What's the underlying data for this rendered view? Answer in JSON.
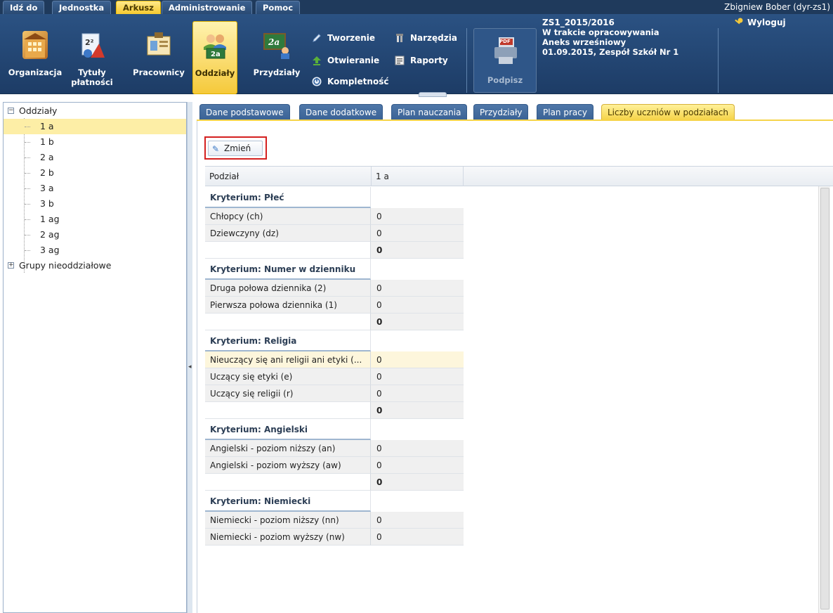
{
  "menu": {
    "items": [
      "Idź do",
      "Jednostka",
      "Arkusz",
      "Administrowanie",
      "Pomoc"
    ],
    "active": "Arkusz",
    "user": "Zbigniew Bober (dyr-zs1)"
  },
  "ribbon": {
    "buttons": [
      "Organizacja",
      "Tytuły płatności",
      "Pracownicy",
      "Oddziały",
      "Przydziały"
    ],
    "tytuly_line1": "Tytuły",
    "tytuly_line2": "płatności",
    "active": "Oddziały",
    "small": {
      "tworzenie": "Tworzenie",
      "otwieranie": "Otwieranie",
      "kompletnosc": "Kompletność",
      "narzedzia": "Narzędzia",
      "raporty": "Raporty"
    },
    "podpisz": "Podpisz",
    "pdf_badge": "PDF",
    "doc": {
      "line1": "ZS1_2015/2016",
      "line2": "W trakcie opracowywania",
      "line3": "Aneks wrześniowy",
      "line4": "01.09.2015, Zespół Szkół Nr 1"
    },
    "wyloguj": "Wyloguj",
    "icon_2a": "2a"
  },
  "tree": {
    "root": "Oddziały",
    "items": [
      "1 a",
      "1 b",
      "2 a",
      "2 b",
      "3 a",
      "3 b",
      "1 ag",
      "2 ag",
      "3 ag"
    ],
    "selected": "1 a",
    "other": "Grupy nieoddziałowe"
  },
  "tabs": [
    "Dane podstawowe",
    "Dane dodatkowe",
    "Plan nauczania",
    "Przydziały",
    "Plan pracy",
    "Liczby uczniów w podziałach"
  ],
  "active_tab": "Liczby uczniów w podziałach",
  "toolbar": {
    "zmien": "Zmień"
  },
  "grid": {
    "headers": [
      "Podział",
      "1 a"
    ],
    "rows": [
      {
        "type": "crit",
        "label": "Kryterium: Płeć",
        "value": ""
      },
      {
        "type": "item",
        "label": "Chłopcy (ch)",
        "value": "0"
      },
      {
        "type": "item",
        "label": "Dziewczyny (dz)",
        "value": "0"
      },
      {
        "type": "sum",
        "label": "",
        "value": "0"
      },
      {
        "type": "crit",
        "label": "Kryterium: Numer w dzienniku",
        "value": ""
      },
      {
        "type": "item",
        "label": "Druga połowa dziennika (2)",
        "value": "0"
      },
      {
        "type": "item",
        "label": "Pierwsza połowa dziennika (1)",
        "value": "0"
      },
      {
        "type": "sum",
        "label": "",
        "value": "0"
      },
      {
        "type": "crit",
        "label": "Kryterium: Religia",
        "value": ""
      },
      {
        "type": "hl",
        "label": "Nieuczący się ani religii ani etyki (...",
        "value": "0"
      },
      {
        "type": "item",
        "label": "Uczący się etyki (e)",
        "value": "0"
      },
      {
        "type": "item",
        "label": "Uczący się religii (r)",
        "value": "0"
      },
      {
        "type": "sum",
        "label": "",
        "value": "0"
      },
      {
        "type": "crit",
        "label": "Kryterium: Angielski",
        "value": ""
      },
      {
        "type": "item",
        "label": "Angielski - poziom niższy (an)",
        "value": "0"
      },
      {
        "type": "item",
        "label": "Angielski - poziom wyższy (aw)",
        "value": "0"
      },
      {
        "type": "sum",
        "label": "",
        "value": "0"
      },
      {
        "type": "crit",
        "label": "Kryterium: Niemiecki",
        "value": ""
      },
      {
        "type": "item",
        "label": "Niemiecki - poziom niższy (nn)",
        "value": "0"
      },
      {
        "type": "item",
        "label": "Niemiecki - poziom wyższy (nw)",
        "value": "0"
      }
    ]
  }
}
